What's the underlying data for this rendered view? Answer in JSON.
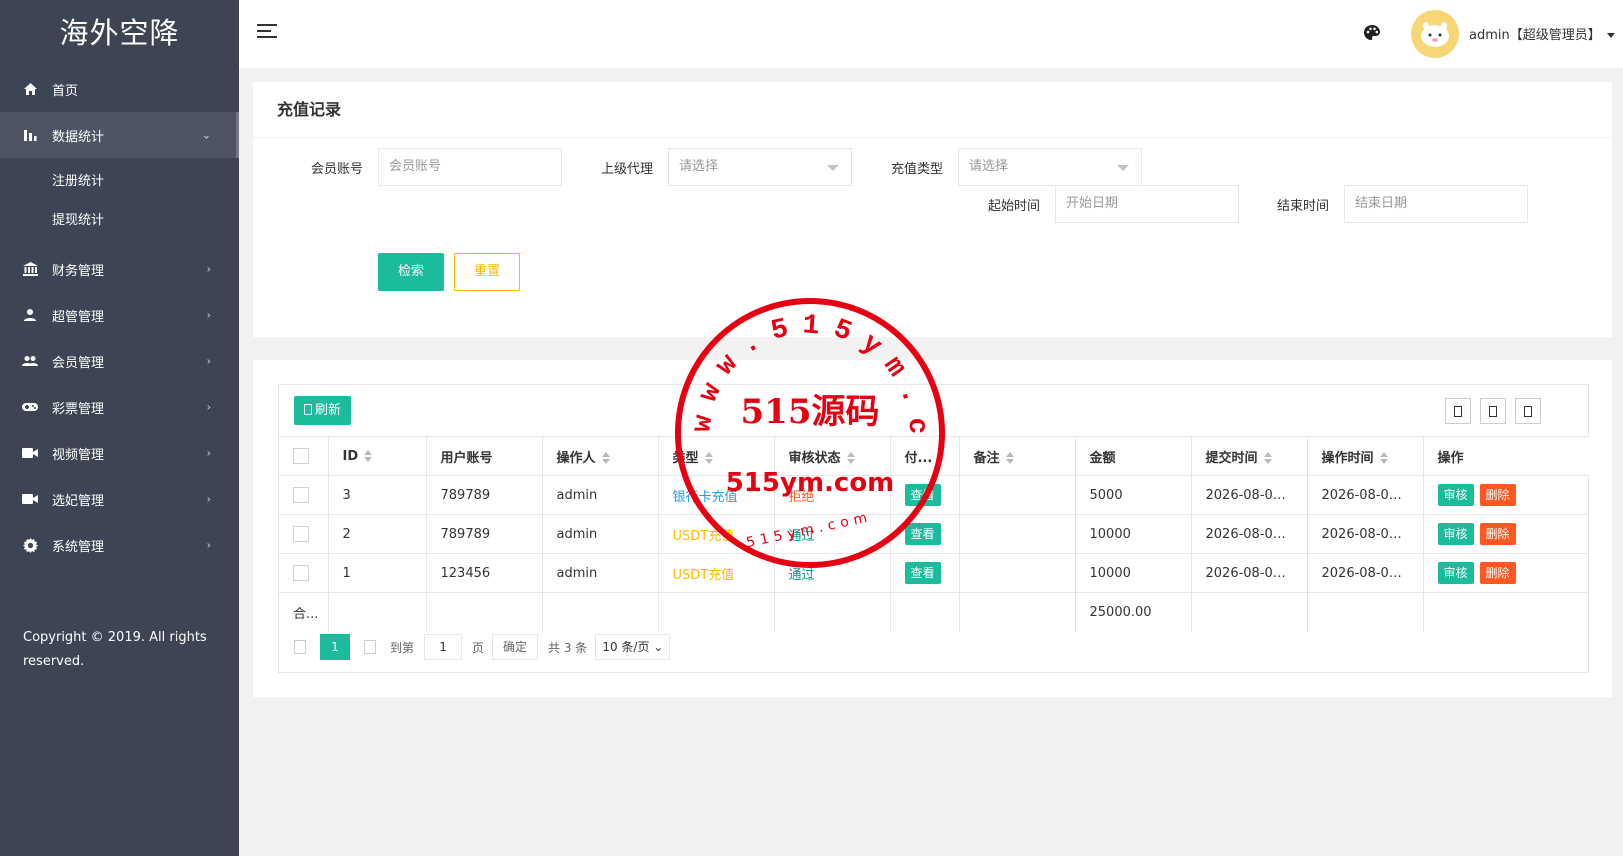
{
  "app": {
    "logo": "海外空降"
  },
  "sidebar": {
    "items": [
      {
        "label": "首页",
        "icon": "home-icon"
      },
      {
        "label": "数据统计",
        "icon": "bar-chart-icon",
        "expanded": true,
        "children": [
          {
            "label": "注册统计"
          },
          {
            "label": "提现统计"
          }
        ]
      },
      {
        "label": "财务管理",
        "icon": "bank-icon"
      },
      {
        "label": "超管管理",
        "icon": "user-icon"
      },
      {
        "label": "会员管理",
        "icon": "users-icon"
      },
      {
        "label": "彩票管理",
        "icon": "gamepad-icon"
      },
      {
        "label": "视频管理",
        "icon": "video-icon"
      },
      {
        "label": "选妃管理",
        "icon": "video-icon"
      },
      {
        "label": "系统管理",
        "icon": "gear-icon"
      }
    ],
    "copyright": "Copyright © 2019. All rights reserved."
  },
  "header": {
    "user": "admin【超级管理员】"
  },
  "search": {
    "title": "充值记录",
    "member_label": "会员账号",
    "member_placeholder": "会员账号",
    "agent_label": "上级代理",
    "agent_placeholder": "请选择",
    "type_label": "充值类型",
    "type_placeholder": "请选择",
    "start_label": "起始时间",
    "start_placeholder": "开始日期",
    "end_label": "结束时间",
    "end_placeholder": "结束日期",
    "search_btn": "检索",
    "reset_btn": "重置"
  },
  "table": {
    "refresh_btn": "刷新",
    "columns": [
      "ID",
      "用户账号",
      "操作人",
      "类型",
      "审核状态",
      "付...",
      "备注",
      "金额",
      "提交时间",
      "操作时间",
      "操作"
    ],
    "rows": [
      {
        "id": "3",
        "account": "789789",
        "operator": "admin",
        "type": "银行卡充值",
        "status": "拒绝",
        "pay": "查看",
        "remark": "",
        "amount": "5000",
        "submit_time": "2026-08-04...",
        "op_time": "2026-08-04...",
        "audit": "审核",
        "delete": "删除"
      },
      {
        "id": "2",
        "account": "789789",
        "operator": "admin",
        "type": "USDT充值",
        "status": "通过",
        "pay": "查看",
        "remark": "",
        "amount": "10000",
        "submit_time": "2026-08-04...",
        "op_time": "2026-08-04...",
        "audit": "审核",
        "delete": "删除"
      },
      {
        "id": "1",
        "account": "123456",
        "operator": "admin",
        "type": "USDT充值",
        "status": "通过",
        "pay": "查看",
        "remark": "",
        "amount": "10000",
        "submit_time": "2026-08-04...",
        "op_time": "2026-08-04...",
        "audit": "审核",
        "delete": "删除"
      }
    ],
    "total_label": "合...",
    "total_amount": "25000.00"
  },
  "pager": {
    "current": "1",
    "goto_label": "到第",
    "goto_value": "1",
    "page_unit": "页",
    "confirm": "确定",
    "total": "共 3 条",
    "page_size": "10 条/页"
  },
  "watermark": {
    "outer_text": "www.515ym.com",
    "center": "515源码",
    "domain": "515ym.com",
    "bottom": "515ym.com"
  }
}
